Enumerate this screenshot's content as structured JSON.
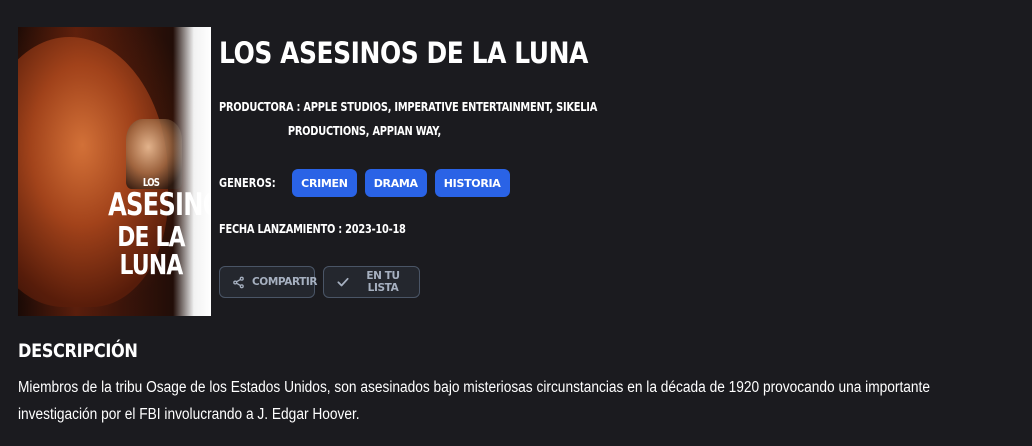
{
  "movie": {
    "title": "LOS ASESINOS DE LA LUNA",
    "poster": {
      "top_text": "LOS",
      "line1": "ASESINOS",
      "line2": "DE LA LUNA"
    }
  },
  "productora": {
    "label": "PRODUCTORA :",
    "line1": "APPLE STUDIOS,  IMPERATIVE ENTERTAINMENT,  SIKELIA",
    "line2": "PRODUCTIONS,  APPIAN WAY,"
  },
  "generos": {
    "label": "GENEROS:",
    "items": [
      "CRIMEN",
      "DRAMA",
      "HISTORIA"
    ]
  },
  "fecha": {
    "label": "FECHA LANZAMIENTO :",
    "value": "2023-10-18"
  },
  "actions": {
    "share_label": "COMPARTIR",
    "share_icon": "share-icon",
    "list_label": "EN TU LISTA",
    "list_icon": "check-icon"
  },
  "description": {
    "heading": "DESCRIPCIÓN",
    "text": "Miembros de la tribu Osage de los Estados Unidos, son asesinados bajo misteriosas circunstancias en la década de 1920 provocando una importante investigación por el FBI involucrando a J. Edgar Hoover."
  },
  "colors": {
    "background": "#1b1b1f",
    "chip": "#2a63e6",
    "button_border": "#4a5566",
    "button_text": "#a6b0c0"
  }
}
